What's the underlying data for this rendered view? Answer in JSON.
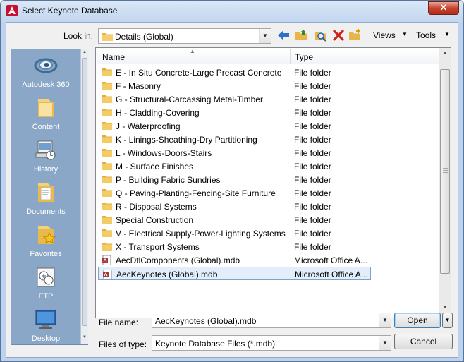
{
  "window": {
    "title": "Select Keynote Database",
    "close_label": "✕"
  },
  "toolbar": {
    "look_in_label": "Look in:",
    "look_in_value": "Details (Global)",
    "views_label": "Views",
    "tools_label": "Tools"
  },
  "places": [
    {
      "label": "Autodesk 360",
      "icon": "autodesk-360-icon"
    },
    {
      "label": "Content",
      "icon": "folder-icon"
    },
    {
      "label": "History",
      "icon": "history-icon"
    },
    {
      "label": "Documents",
      "icon": "documents-icon"
    },
    {
      "label": "Favorites",
      "icon": "favorites-icon"
    },
    {
      "label": "FTP",
      "icon": "ftp-icon"
    },
    {
      "label": "Desktop",
      "icon": "desktop-icon"
    }
  ],
  "list": {
    "columns": {
      "name": "Name",
      "type": "Type"
    },
    "rows": [
      {
        "name": "E - In Situ Concrete-Large Precast Concrete",
        "type": "File folder",
        "kind": "folder"
      },
      {
        "name": "F - Masonry",
        "type": "File folder",
        "kind": "folder"
      },
      {
        "name": "G - Structural-Carcassing Metal-Timber",
        "type": "File folder",
        "kind": "folder"
      },
      {
        "name": "H - Cladding-Covering",
        "type": "File folder",
        "kind": "folder"
      },
      {
        "name": "J - Waterproofing",
        "type": "File folder",
        "kind": "folder"
      },
      {
        "name": "K - Linings-Sheathing-Dry Partitioning",
        "type": "File folder",
        "kind": "folder"
      },
      {
        "name": "L - Windows-Doors-Stairs",
        "type": "File folder",
        "kind": "folder"
      },
      {
        "name": "M - Surface Finishes",
        "type": "File folder",
        "kind": "folder"
      },
      {
        "name": "P - Building Fabric Sundries",
        "type": "File folder",
        "kind": "folder"
      },
      {
        "name": "Q - Paving-Planting-Fencing-Site Furniture",
        "type": "File folder",
        "kind": "folder"
      },
      {
        "name": "R - Disposal Systems",
        "type": "File folder",
        "kind": "folder"
      },
      {
        "name": "Special Construction",
        "type": "File folder",
        "kind": "folder"
      },
      {
        "name": "V - Electrical Supply-Power-Lighting Systems",
        "type": "File folder",
        "kind": "folder"
      },
      {
        "name": "X - Transport Systems",
        "type": "File folder",
        "kind": "folder"
      },
      {
        "name": "AecDtlComponents (Global).mdb",
        "type": "Microsoft Office A...",
        "kind": "mdb"
      },
      {
        "name": "AecKeynotes (Global).mdb",
        "type": "Microsoft Office A...",
        "kind": "mdb",
        "selected": true
      }
    ]
  },
  "file_name": {
    "label": "File name:",
    "value": "AecKeynotes (Global).mdb"
  },
  "file_type": {
    "label": "Files of type:",
    "value": "Keynote Database Files (*.mdb)"
  },
  "buttons": {
    "open": "Open",
    "cancel": "Cancel"
  },
  "colors": {
    "places_bg": "#8aa7c7",
    "title_bg": "#c2d6ef",
    "close_red": "#c7442f",
    "selection": "#e3eefb"
  }
}
